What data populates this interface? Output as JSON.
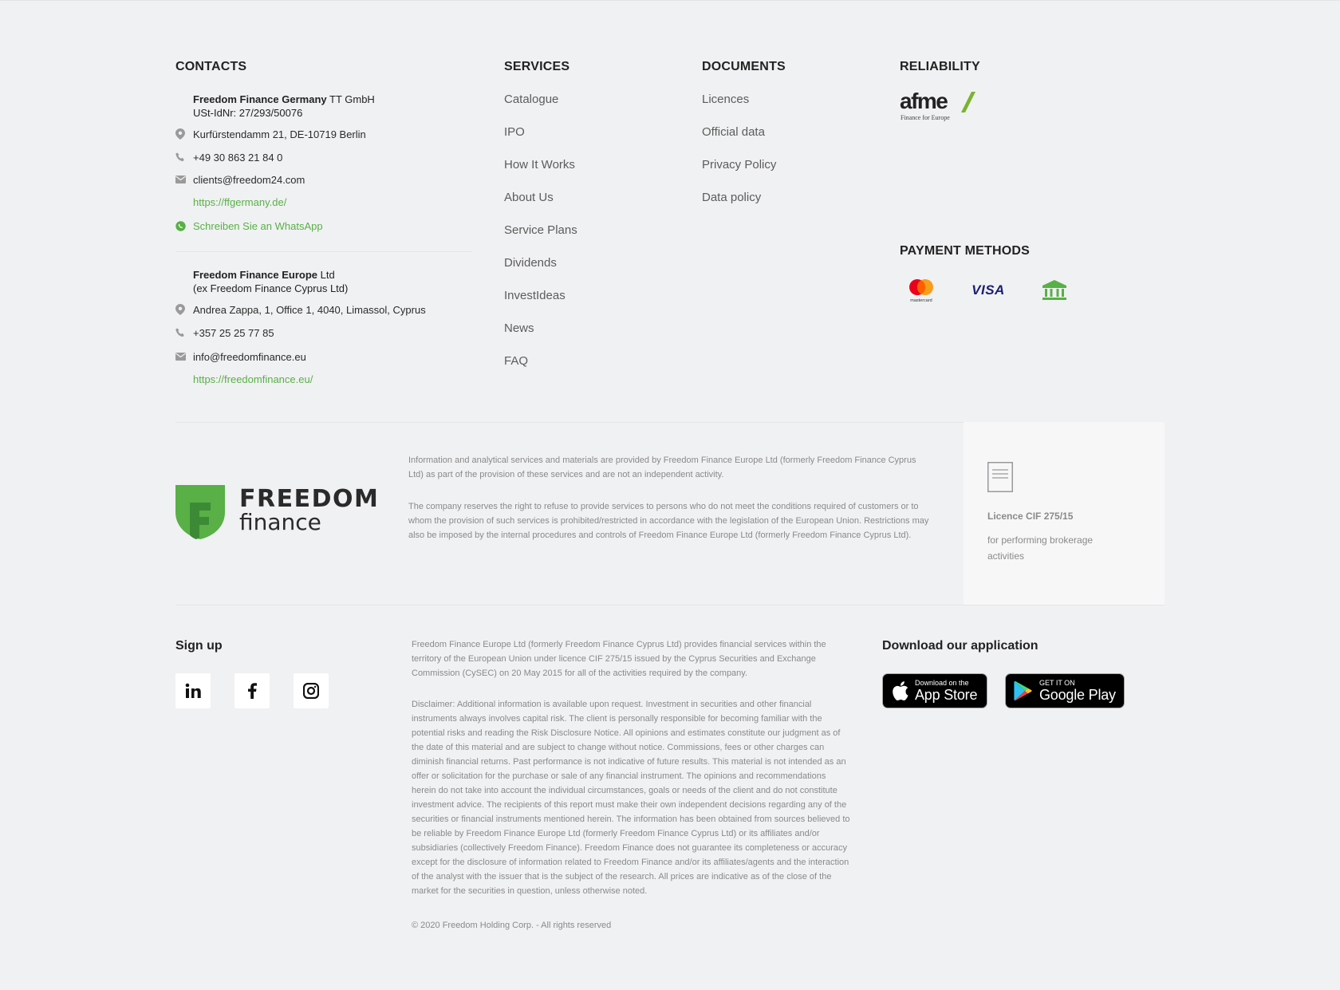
{
  "contacts": {
    "heading": "CONTACTS",
    "germany": {
      "name_bold": "Freedom Finance Germany",
      "name_rest": " TT GmbH",
      "ust": "USt-IdNr: 27/293/50076",
      "address": "Kurfürstendamm 21, DE-10719 Berlin",
      "phone": "+49 30 863 21 84 0",
      "email": "clients@freedom24.com",
      "website": "https://ffgermany.de/",
      "whatsapp": "Schreiben Sie an WhatsApp"
    },
    "europe": {
      "name_bold": "Freedom Finance Europe",
      "name_rest": " Ltd",
      "former": "(ex Freedom Finance Cyprus Ltd)",
      "address": "Andrea Zappa, 1, Office 1, 4040, Limassol, Cyprus",
      "phone": "+357 25 25 77 85",
      "email": "info@freedomfinance.eu",
      "website": "https://freedomfinance.eu/"
    }
  },
  "services": {
    "heading": "SERVICES",
    "items": [
      "Catalogue",
      "IPO",
      "How It Works",
      "About Us",
      "Service Plans",
      "Dividends",
      "InvestIdeas",
      "News",
      "FAQ"
    ]
  },
  "documents": {
    "heading": "DOCUMENTS",
    "items": [
      "Licences",
      "Official data",
      "Privacy Policy",
      "Data policy"
    ]
  },
  "reliability": {
    "heading": "RELIABILITY",
    "afme_logo_text": "afme",
    "afme_tagline": "Finance for Europe"
  },
  "payment": {
    "heading": "PAYMENT METHODS",
    "methods": [
      "mastercard-icon",
      "visa-icon",
      "bank-icon"
    ],
    "mastercard_label": "mastercard",
    "visa_label": "VISA"
  },
  "brand": {
    "word1": "FREEDOM",
    "word2": "finance",
    "green": "#58b046",
    "dark_green": "#3d8a36"
  },
  "legal": {
    "para1": "Information and analytical services and materials are provided by Freedom Finance Europe Ltd (formerly Freedom Finance Cyprus Ltd) as part of the provision of these services and are not an independent activity.",
    "para2": "The company reserves the right to refuse to provide services to persons who do not meet the conditions required of customers or to whom the provision of such services is prohibited/restricted in accordance with the legislation of the European Union. Restrictions may also be imposed by the internal procedures and controls of Freedom Finance Europe Ltd (formerly Freedom Finance Cyprus Ltd)."
  },
  "licence": {
    "title": "Licence CIF 275/15",
    "text": "for performing brokerage activities"
  },
  "signup": {
    "heading": "Sign up",
    "socials": [
      "linkedin-icon",
      "facebook-icon",
      "instagram-icon"
    ]
  },
  "disclaimer": {
    "para1": "Freedom Finance Europe Ltd (formerly Freedom Finance Cyprus Ltd) provides financial services within the territory of the European Union under licence CIF 275/15 issued by the Cyprus Securities and Exchange Commission (CySEC) on 20 May 2015 for all of the activities required by the company.",
    "para2": "Disclaimer: Additional information is available upon request. Investment in securities and other financial instruments always involves capital risk. The client is personally responsible for becoming familiar with the potential risks and reading the Risk Disclosure Notice. All opinions and estimates constitute our judgment as of the date of this material and are subject to change without notice. Commissions, fees or other charges can diminish financial returns. Past performance is not indicative of future results. This material is not intended as an offer or solicitation for the purchase or sale of any financial instrument. The opinions and recommendations herein do not take into account the individual circumstances, goals or needs of the client and do not constitute investment advice. The recipients of this report must make their own independent decisions regarding any of the securities or financial instruments mentioned herein. The information has been obtained from sources believed to be reliable by Freedom Finance Europe Ltd (formerly Freedom Finance Cyprus Ltd) or its affiliates and/or subsidiaries (collectively Freedom Finance). Freedom Finance does not guarantee its completeness or accuracy except for the disclosure of information related to Freedom Finance and/or its affiliates/agents and the interaction of the analyst with the issuer that is the subject of the research. All prices are indicative as of the close of the market for the securities in question, unless otherwise noted.",
    "copyright": "© 2020 Freedom Holding Corp. - All rights reserved"
  },
  "apps": {
    "heading": "Download our application",
    "appstore_small": "Download on the",
    "appstore_big": "App Store",
    "googleplay_small": "GET IT ON",
    "googleplay_big": "Google Play"
  }
}
